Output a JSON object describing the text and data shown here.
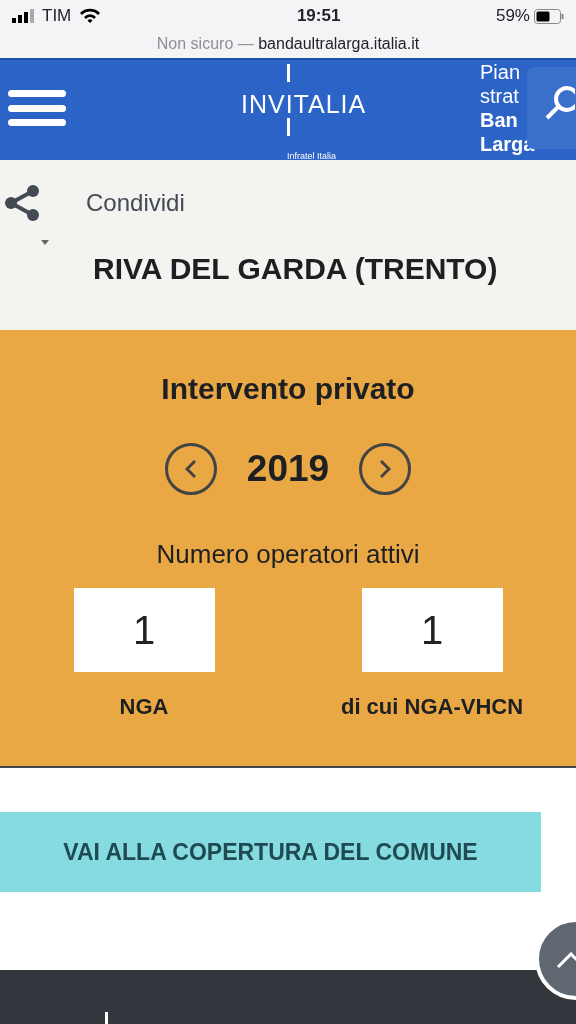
{
  "status_bar": {
    "carrier": "TIM",
    "time": "19:51",
    "battery": "59%"
  },
  "address_bar": {
    "security": "Non sicuro —",
    "domain": "bandaultralarga.italia.it"
  },
  "header": {
    "logo": "INVITALIA",
    "logo_subtitle": "Infratel Italia",
    "side_title": [
      "Pian",
      "strat",
      "Ban",
      "Larga"
    ]
  },
  "share": {
    "label": "Condividi"
  },
  "place": {
    "title": "RIVA DEL GARDA (TRENTO)"
  },
  "panel": {
    "title": "Intervento privato",
    "year": "2019",
    "subtitle": "Numero operatori attivi",
    "counters": [
      {
        "value": "1",
        "label": "NGA"
      },
      {
        "value": "1",
        "label": "di cui NGA-VHCN"
      }
    ]
  },
  "coverage_button": {
    "label": "VAI ALLA COPERTURA DEL COMUNE"
  }
}
